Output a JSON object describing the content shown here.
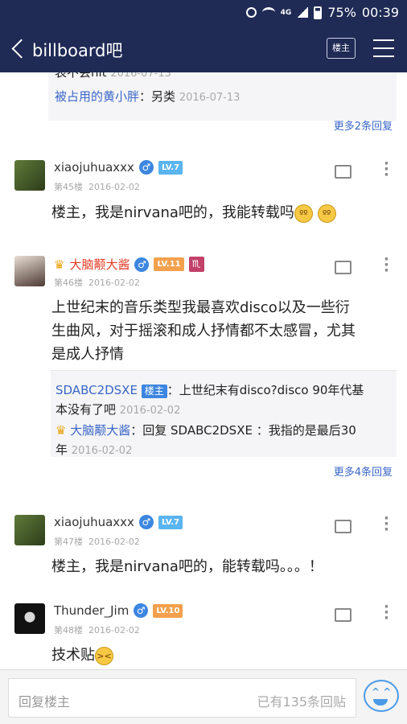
{
  "status_bar": {
    "battery": "75%",
    "time": "00:39",
    "network": "4G"
  },
  "header": {
    "title": "billboard吧",
    "louzhu_button": "楼主"
  },
  "top_subreplies": {
    "partial_text": "表不会hit",
    "partial_date": "2016-07-13",
    "line2_user": "被占用的黄小胖",
    "line2_text": "：另类",
    "line2_date": "2016-07-13",
    "more": "更多2条回复"
  },
  "posts": [
    {
      "username": "xiaojuhuaxxx",
      "level": "LV.7",
      "floor": "第45楼",
      "date": "2016-02-02",
      "text": "楼主，我是nirvana吧的，我能转载吗"
    },
    {
      "username": "大脑颟大酱",
      "level": "LV.11",
      "zodiac": "♏",
      "floor": "第46楼",
      "date": "2016-02-02",
      "text_line1": "上世纪末的音乐类型我最喜欢disco以及一些衍",
      "text_line2": "生曲风，对于摇滚和成人抒情都不太感冒，尤其",
      "text_line3": "是成人抒情",
      "subreplies": [
        {
          "user": "SDABC2DSXE",
          "badge": "楼主",
          "text": "：上世纪末有disco?disco 90年代基",
          "text2": "本没有了吧",
          "date": "2016-02-02"
        },
        {
          "user": "大脑颟大酱",
          "text": "：回复 SDABC2DSXE ：我指的是最后30",
          "text2": "年",
          "date": "2016-02-02"
        }
      ],
      "more": "更多4条回复"
    },
    {
      "username": "xiaojuhuaxxx",
      "level": "LV.7",
      "floor": "第47楼",
      "date": "2016-02-02",
      "text": "楼主，我是nirvana吧的，能转载吗。。。！"
    },
    {
      "username": "Thunder_Jim",
      "level": "LV.10",
      "floor": "第48楼",
      "date": "2016-02-02",
      "text": "技术贴"
    }
  ],
  "bottom": {
    "placeholder": "回复楼主",
    "reply_count": "已有135条回贴"
  },
  "colors": {
    "header_bg": "#1f2a55",
    "link_blue": "#3a66c7",
    "name_red": "#e33b24"
  }
}
